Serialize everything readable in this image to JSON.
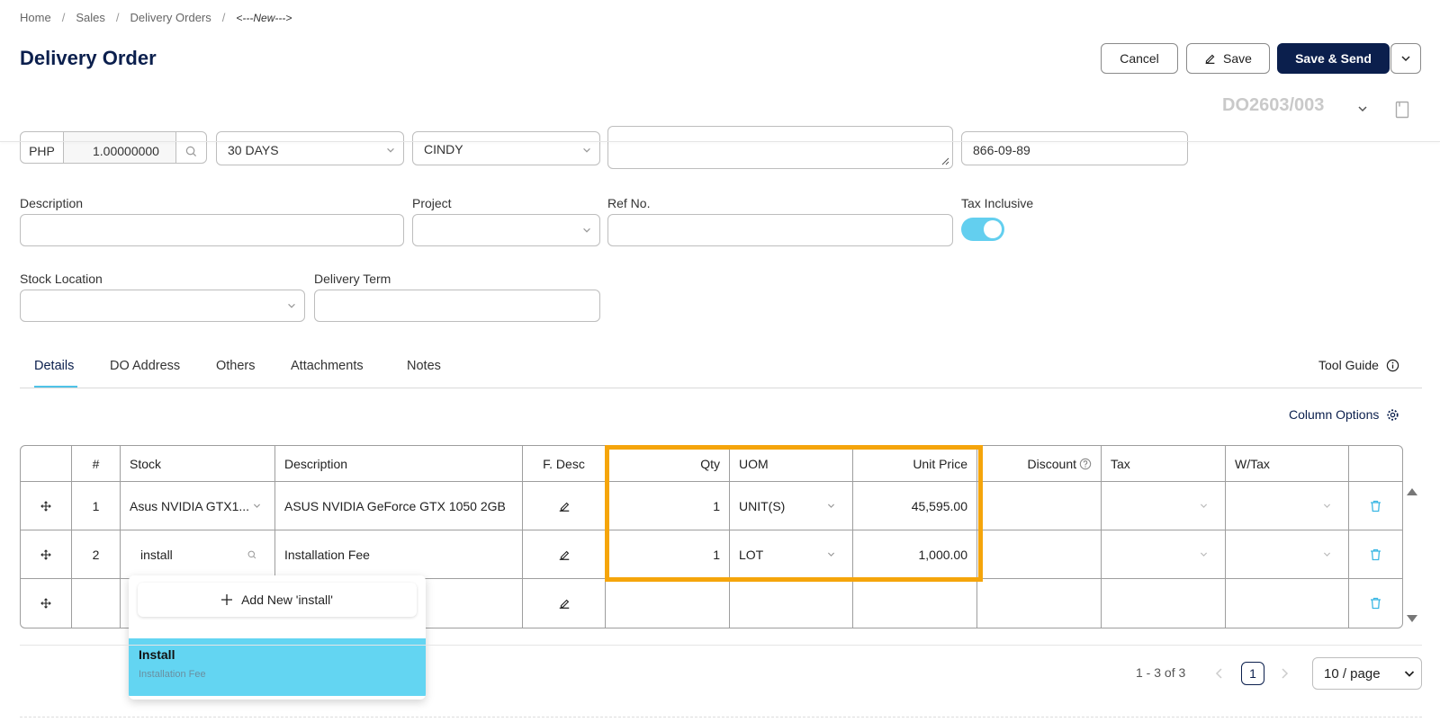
{
  "breadcrumb": {
    "home": "Home",
    "sales": "Sales",
    "delivery_orders": "Delivery Orders",
    "current": "<---New--->"
  },
  "page_title": "Delivery Order",
  "actions": {
    "cancel": "Cancel",
    "save": "Save",
    "save_send": "Save & Send"
  },
  "doc_no": "DO2603/003",
  "top_row": {
    "currency": "PHP",
    "rate": "1.00000000",
    "terms": "30 DAYS",
    "agent": "CINDY",
    "phone": "866-09-89"
  },
  "form": {
    "description_label": "Description",
    "project_label": "Project",
    "ref_no_label": "Ref No.",
    "tax_inclusive_label": "Tax Inclusive",
    "tax_inclusive_on": true,
    "stock_location_label": "Stock Location",
    "delivery_term_label": "Delivery Term"
  },
  "tabs": [
    "Details",
    "DO Address",
    "Others",
    "Attachments",
    "Notes"
  ],
  "tool_guide": "Tool Guide",
  "column_options": "Column Options",
  "table": {
    "headers": {
      "num": "#",
      "stock": "Stock",
      "description": "Description",
      "fdesc": "F. Desc",
      "qty": "Qty",
      "uom": "UOM",
      "unit_price": "Unit Price",
      "discount": "Discount",
      "tax": "Tax",
      "wtax": "W/Tax"
    },
    "rows": [
      {
        "num": "1",
        "stock": "Asus NVIDIA GTX1...",
        "description": "ASUS NVIDIA GeForce GTX 1050 2GB",
        "qty": "1",
        "uom": "UNIT(S)",
        "unit_price": "45,595.00"
      },
      {
        "num": "2",
        "stock": "install",
        "description": "Installation Fee",
        "qty": "1",
        "uom": "LOT",
        "unit_price": "1,000.00"
      }
    ]
  },
  "dropdown": {
    "add_new": "Add New 'install'",
    "item_title": "Install",
    "item_sub": "Installation Fee"
  },
  "pager": {
    "range": "1 - 3 of 3",
    "current": "1",
    "page_size": "10 / page"
  },
  "colors": {
    "navy": "#0b1f4d",
    "accent": "#63cfef",
    "highlight": "#f5a50b"
  }
}
